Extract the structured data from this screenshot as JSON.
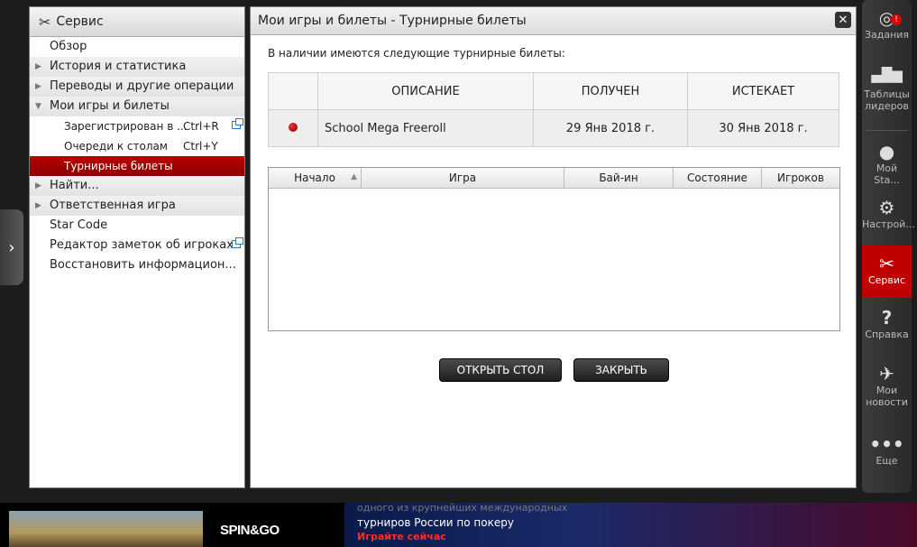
{
  "sidebar": {
    "title": "Сервис",
    "items": [
      {
        "label": "Обзор",
        "level": 0
      },
      {
        "label": "История и статистика",
        "level": 0
      },
      {
        "label": "Переводы и другие операции",
        "level": 0
      },
      {
        "label": "Мои игры и билеты",
        "level": 0
      },
      {
        "label": "Зарегистрирован в ...",
        "shortcut": "Ctrl+R",
        "level": 1
      },
      {
        "label": "Очереди к столам",
        "shortcut": "Ctrl+Y",
        "level": 1
      },
      {
        "label": "Турнирные билеты",
        "level": 1
      },
      {
        "label": "Найти...",
        "level": 0
      },
      {
        "label": "Ответственная игра",
        "level": 0
      },
      {
        "label": "Star Code",
        "level": 0
      },
      {
        "label": "Редактор заметок об игроках",
        "level": 0
      },
      {
        "label": "Восстановить информацион...",
        "level": 0
      }
    ]
  },
  "main": {
    "title": "Мои игры и билеты - Турнирные билеты",
    "intro": "В наличии имеются следующие турнирные билеты:",
    "tickets": {
      "headers": [
        "ОПИСАНИЕ",
        "ПОЛУЧЕН",
        "ИСТЕКАЕТ"
      ],
      "rows": [
        {
          "description": "School Mega Freeroll",
          "received": "29 Янв 2018 г.",
          "expires": "30 Янв 2018 г."
        }
      ]
    },
    "games": {
      "headers": [
        "Начало",
        "Игра",
        "Бай-ин",
        "Состояние",
        "Игроков"
      ]
    },
    "buttons": {
      "open_table": "ОТКРЫТЬ СТОЛ",
      "close": "ЗАКРЫТЬ"
    }
  },
  "close_icon": "✕",
  "rail": {
    "tasks": "Задания",
    "tasks_badge": "!",
    "leaderboards_1": "Таблицы",
    "leaderboards_2": "лидеров",
    "my_stars": "Мой Sta...",
    "settings": "Настрой...",
    "service": "Сервис",
    "help": "Справка",
    "news_1": "Мои",
    "news_2": "новости",
    "more": "Еще"
  },
  "banner": {
    "line0": "одного из крупнейших международных",
    "line1": "турниров России по покеру",
    "line2": "Играйте сейчас",
    "logo": "SPIN&GO"
  },
  "colors": {
    "accent": "#c00000",
    "rail_bg": "#333333"
  }
}
